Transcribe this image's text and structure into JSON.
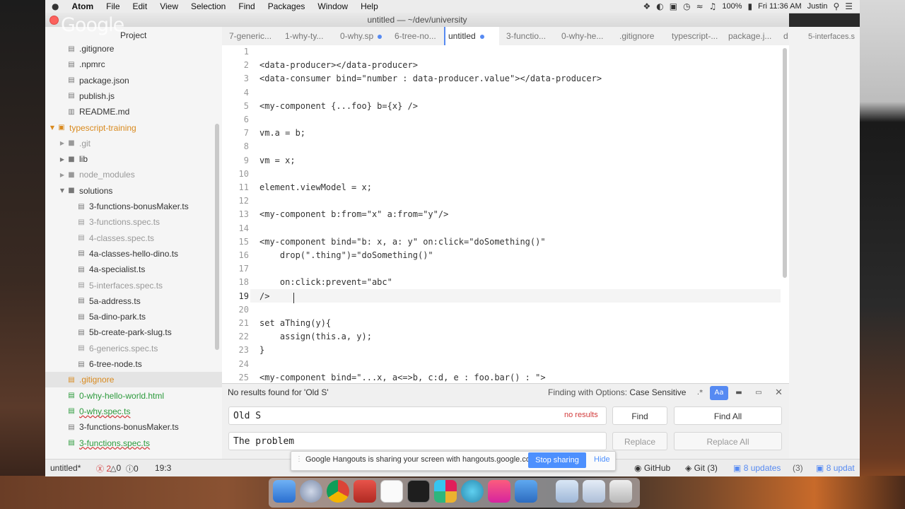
{
  "menubar": {
    "apple": "",
    "app_name": "Atom",
    "menus": [
      "File",
      "Edit",
      "View",
      "Selection",
      "Find",
      "Packages",
      "Window",
      "Help"
    ],
    "battery": "100%",
    "clock": "Fri 11:36 AM",
    "user": "Justin"
  },
  "window": {
    "title": "untitled — ~/dev/university"
  },
  "overlay_logo": "Google",
  "sidebar": {
    "header": "Project",
    "items": [
      {
        "label": ".gitignore",
        "icon": "file-icon"
      },
      {
        "label": ".npmrc",
        "icon": "file-icon"
      },
      {
        "label": "package.json",
        "icon": "file-icon"
      },
      {
        "label": "publish.js",
        "icon": "file-icon"
      },
      {
        "label": "README.md",
        "icon": "book-icon"
      },
      {
        "label": "typescript-training",
        "icon": "repo-icon"
      },
      {
        "label": ".git",
        "icon": "folder-icon"
      },
      {
        "label": "lib",
        "icon": "folder-icon"
      },
      {
        "label": "node_modules",
        "icon": "folder-icon"
      },
      {
        "label": "solutions",
        "icon": "folder-icon"
      },
      {
        "label": "3-functions-bonusMaker.ts",
        "icon": "file-icon"
      },
      {
        "label": "3-functions.spec.ts",
        "icon": "file-icon"
      },
      {
        "label": "4-classes.spec.ts",
        "icon": "file-icon"
      },
      {
        "label": "4a-classes-hello-dino.ts",
        "icon": "file-icon"
      },
      {
        "label": "4a-specialist.ts",
        "icon": "file-icon"
      },
      {
        "label": "5-interfaces.spec.ts",
        "icon": "file-icon"
      },
      {
        "label": "5a-address.ts",
        "icon": "file-icon"
      },
      {
        "label": "5a-dino-park.ts",
        "icon": "file-icon"
      },
      {
        "label": "5b-create-park-slug.ts",
        "icon": "file-icon"
      },
      {
        "label": "6-generics.spec.ts",
        "icon": "file-icon"
      },
      {
        "label": "6-tree-node.ts",
        "icon": "file-icon"
      },
      {
        "label": ".gitignore",
        "icon": "file-icon"
      },
      {
        "label": "0-why-hello-world.html",
        "icon": "file-icon"
      },
      {
        "label": "0-why.spec.ts",
        "icon": "file-icon"
      },
      {
        "label": "3-functions-bonusMaker.ts",
        "icon": "file-icon"
      },
      {
        "label": "3-functions.spec.ts",
        "icon": "file-icon"
      }
    ]
  },
  "tabs": [
    {
      "label": "7-generic..."
    },
    {
      "label": "1-why-ty..."
    },
    {
      "label": "0-why.sp"
    },
    {
      "label": "6-tree-no..."
    },
    {
      "label": "untitled"
    },
    {
      "label": "3-functio..."
    },
    {
      "label": "0-why-he..."
    },
    {
      "label": ".gitignore"
    },
    {
      "label": "typescript-..."
    },
    {
      "label": "package.j..."
    },
    {
      "label": "d"
    }
  ],
  "ghost_tab": "5-interfaces.s",
  "editor": {
    "lines": [
      "",
      "<data-producer></data-producer>",
      "<data-consumer bind=\"number : data-producer.value\"></data-producer>",
      "",
      "<my-component {...foo} b={x} />",
      "",
      "vm.a = b;",
      "",
      "vm = x;",
      "",
      "element.viewModel = x;",
      "",
      "<my-component b:from=\"x\" a:from=\"y\"/>",
      "",
      "<my-component bind=\"b: x, a: y\" on:click=\"doSomething()\"",
      "    drop(\".thing\")=\"doSomething()\"",
      "",
      "    on:click:prevent=\"abc\"",
      "/>",
      "",
      "set aThing(y){",
      "    assign(this.a, y);",
      "}",
      "",
      "<my-component bind=\"...x, a<=>b, c:d, e : foo.bar() : \">"
    ]
  },
  "find": {
    "message": "No results found for 'Old S'",
    "options_label": "Finding with Options:",
    "options_value": "Case Sensitive",
    "find_value": "Old S",
    "results": "no results",
    "find_label": "Find",
    "find_all_label": "Find All",
    "replace_value": "The problem",
    "replace_label": "Replace",
    "replace_all_label": "Replace All",
    "opt_regex": ".*",
    "opt_case": "Aa"
  },
  "status": {
    "file": "untitled*",
    "errors": "2",
    "warnings": "0",
    "infos": "0",
    "cursor": "19:3",
    "github": "GitHub",
    "git": "Git (3)",
    "updates": "8 updates",
    "ghost_git": "(3)",
    "ghost_updates": "8 updat"
  },
  "hangouts": {
    "text": "Google Hangouts is sharing your screen with hangouts.google.com.",
    "stop": "Stop sharing",
    "hide": "Hide"
  },
  "colors": {
    "accent": "#568af2",
    "error": "#d23b3b",
    "git_modified": "#d98a1e",
    "git_added": "#2c9a3c",
    "hangouts_blue": "#4d90fe"
  }
}
